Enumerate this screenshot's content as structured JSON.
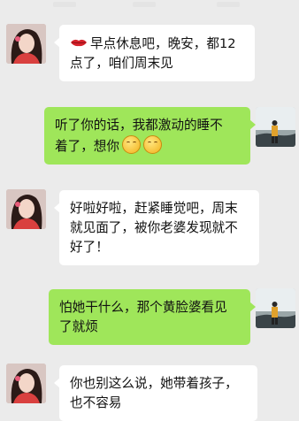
{
  "colors": {
    "background": "#ebebeb",
    "incoming_bubble": "#ffffff",
    "outgoing_bubble": "#9fe65a"
  },
  "messages": [
    {
      "side": "left",
      "avatar": "contact-avatar",
      "emoji": "lips-icon",
      "line1": "早点休息吧，晚安，都12",
      "line2": "点了，咱们周末见"
    },
    {
      "side": "right",
      "avatar": "user-avatar",
      "line1": "听了你的话，我都激动的睡不",
      "line2": "着了，想你",
      "emoji": [
        "kiss-face-icon",
        "kiss-face-icon"
      ]
    },
    {
      "side": "left",
      "avatar": "contact-avatar",
      "line1": "好啦好啦，赶紧睡觉吧，周末",
      "line2": "就见面了，被你老婆发现就不",
      "line3": "好了！"
    },
    {
      "side": "right",
      "avatar": "user-avatar",
      "line1": "怕她干什么，那个黄脸婆看见",
      "line2": "了就烦"
    },
    {
      "side": "left",
      "avatar": "contact-avatar",
      "line1": "你也别这么说，她带着孩子，",
      "line2": "也不容易"
    }
  ]
}
